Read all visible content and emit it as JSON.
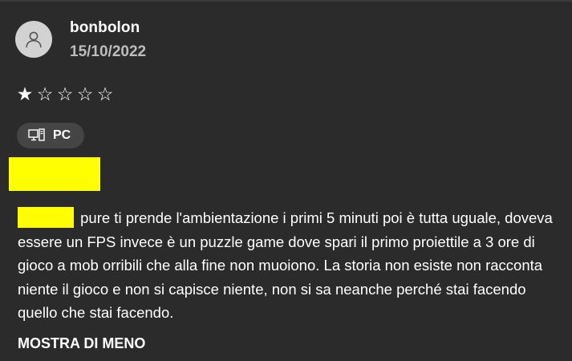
{
  "review": {
    "author": "bonbolon",
    "date": "15/10/2022",
    "rating": {
      "value": 1,
      "max": 5,
      "filled_glyph": "★",
      "empty_glyph": "☆"
    },
    "platform": {
      "label": "PC",
      "icon": "pc-monitor-icon"
    },
    "body": "pure ti prende l'ambientazione i primi 5 minuti poi è tutta uguale, doveva essere un FPS invece è un puzzle game dove spari il primo proiettile a 3 ore di gioco a mob orribili che alla fine non muoiono. La storia non esiste non racconta niente il gioco e non si capisce niente, non si sa neanche perché stai facendo quello che stai facendo.",
    "toggle_label": "MOSTRA DI MENO"
  },
  "colors": {
    "background": "#2b2b2b",
    "avatar": "#d2d2d2",
    "chip": "#454545",
    "date": "#bdbdbd",
    "redaction": "#ffff00"
  }
}
